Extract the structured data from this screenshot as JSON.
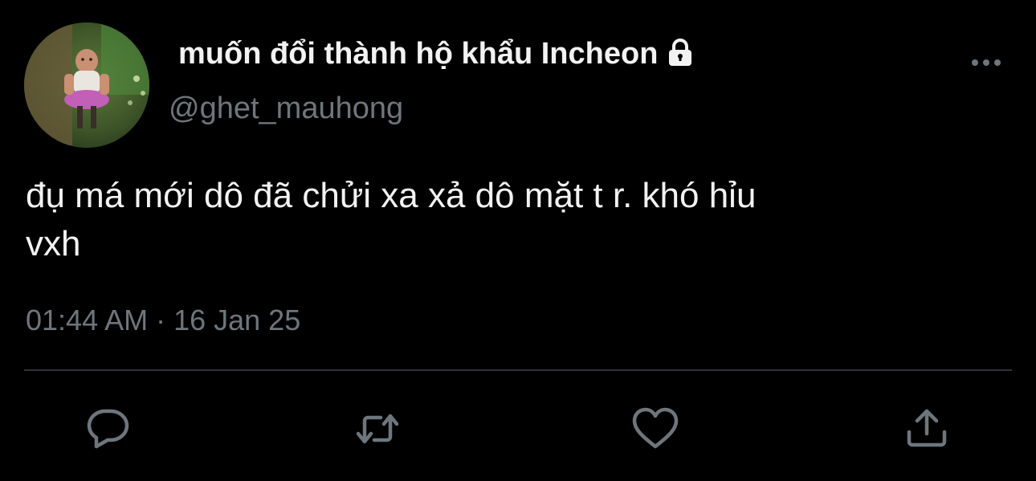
{
  "tweet": {
    "display_name": "muốn đổi thành hộ khẩu Incheon",
    "handle": "@ghet_mauhong",
    "text": "đụ má mới dô đã chửi xa xả dô mặt t r. khó hỉu\nvxh",
    "timestamp": "01:44 AM · 16 Jan 25",
    "protected_account_icon": "lock-icon",
    "avatar_icon": "cartoon-character-avatar"
  },
  "actions": {
    "more": "more-dots-icon",
    "reply": "reply-bubble-icon",
    "retweet": "retweet-arrows-icon",
    "like": "heart-icon",
    "share": "share-upload-icon"
  },
  "colors": {
    "background": "#000000",
    "primary_text": "#f2f2f2",
    "secondary_text": "#6e767d",
    "divider": "#2f3336"
  }
}
